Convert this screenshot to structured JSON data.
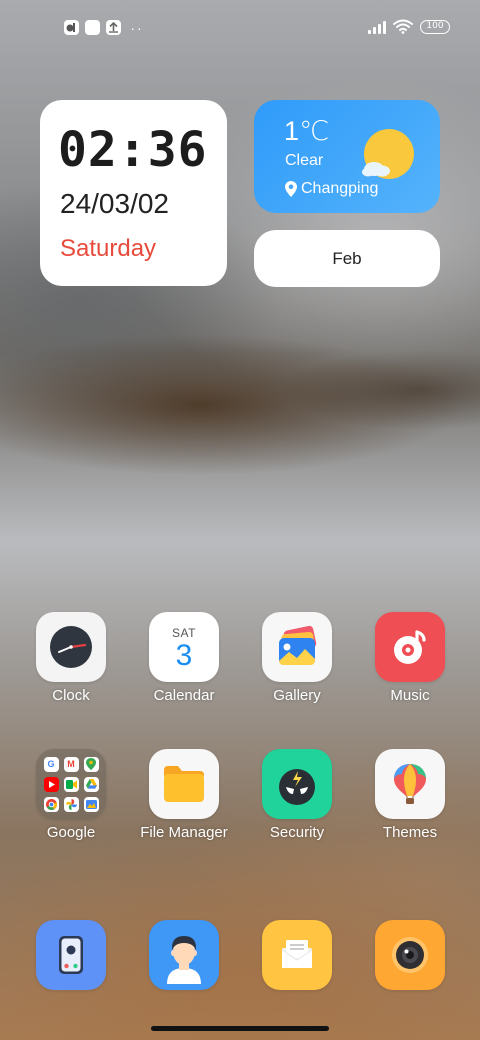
{
  "status_bar": {
    "left_icons": [
      "notification-app-icon",
      "notification-square-icon",
      "notification-arrow-icon",
      "more-dots-icon"
    ],
    "battery": "100"
  },
  "clock_widget": {
    "time": "02:36",
    "date": "24/03/02",
    "day": "Saturday"
  },
  "weather_widget": {
    "temperature": "1℃",
    "condition": "Clear",
    "location": "Changping"
  },
  "month_widget": {
    "month": "Feb"
  },
  "calendar_icon": {
    "weekday": "SAT",
    "day": "3"
  },
  "apps_row1": [
    {
      "label": "Clock",
      "icon": "clock-app-icon"
    },
    {
      "label": "Calendar",
      "icon": "calendar-app-icon"
    },
    {
      "label": "Gallery",
      "icon": "gallery-app-icon"
    },
    {
      "label": "Music",
      "icon": "music-app-icon"
    }
  ],
  "apps_row2": [
    {
      "label": "Google",
      "icon": "google-folder-icon"
    },
    {
      "label": "File Manager",
      "icon": "file-manager-app-icon"
    },
    {
      "label": "Security",
      "icon": "security-app-icon"
    },
    {
      "label": "Themes",
      "icon": "themes-app-icon"
    }
  ],
  "dock": [
    {
      "icon": "phone-app-icon"
    },
    {
      "icon": "contacts-app-icon"
    },
    {
      "icon": "messages-app-icon"
    },
    {
      "icon": "camera-app-icon"
    }
  ],
  "colors": {
    "weather_gradient_start": "#2f9bfa",
    "day_text": "#e84a3b",
    "calendar_accent": "#1b8ef2"
  }
}
